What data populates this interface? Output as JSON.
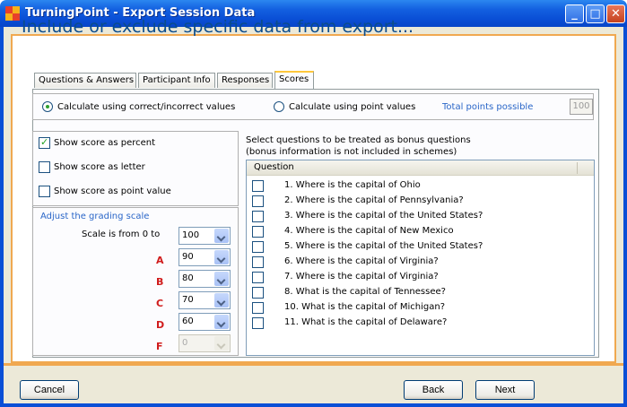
{
  "window": {
    "title": "TurningPoint - Export Session Data",
    "minimize_glyph": "_",
    "maximize_glyph": "□",
    "close_glyph": "✕"
  },
  "heading": "Include or exclude specific data from export...",
  "tabs": [
    {
      "label": "Questions & Answers",
      "active": false
    },
    {
      "label": "Participant Info",
      "active": false
    },
    {
      "label": "Responses",
      "active": false
    },
    {
      "label": "Scores",
      "active": true
    }
  ],
  "calculation": {
    "option_correct": "Calculate using correct/incorrect values",
    "option_points": "Calculate using point values",
    "selected": "correct",
    "total_points_label": "Total points possible",
    "total_points_value": "100"
  },
  "score_options": [
    {
      "label": "Show score as percent",
      "checked": true
    },
    {
      "label": "Show score as letter",
      "checked": false
    },
    {
      "label": "Show score as point value",
      "checked": false
    }
  ],
  "grading": {
    "title": "Adjust the grading scale",
    "scale_label": "Scale is from 0 to",
    "scale_value": "100",
    "grades": [
      {
        "letter": "A",
        "value": "90",
        "disabled": false
      },
      {
        "letter": "B",
        "value": "80",
        "disabled": false
      },
      {
        "letter": "C",
        "value": "70",
        "disabled": false
      },
      {
        "letter": "D",
        "value": "60",
        "disabled": false
      },
      {
        "letter": "F",
        "value": "0",
        "disabled": true
      }
    ]
  },
  "bonus": {
    "instructions_line1": "Select questions to be treated as bonus questions",
    "instructions_line2": "(bonus information is not included in schemes)",
    "column_header": "Question",
    "questions": [
      "1.  Where is the capital of  Ohio",
      "2.  Where is the capital of Pennsylvania?",
      "3.  Where is the capital of the United States?",
      "4.  Where is the capital of New Mexico",
      "5.  Where is the capital of the United States?",
      "6.  Where is the capital of Virginia?",
      "7.  Where is the capital of Virginia?",
      "8.  What is the capital of Tennessee?",
      "10.  What is the capital of Michigan?",
      "11.  What is the capital of Delaware?"
    ]
  },
  "buttons": {
    "cancel": "Cancel",
    "back": "Back",
    "next": "Next"
  },
  "colors": {
    "title_bar": "#0a4fd6",
    "accent_border": "#f0a850",
    "heading_text": "#0b4c8c",
    "grade_letter": "#d01c1c",
    "link_text": "#2a66c8"
  }
}
